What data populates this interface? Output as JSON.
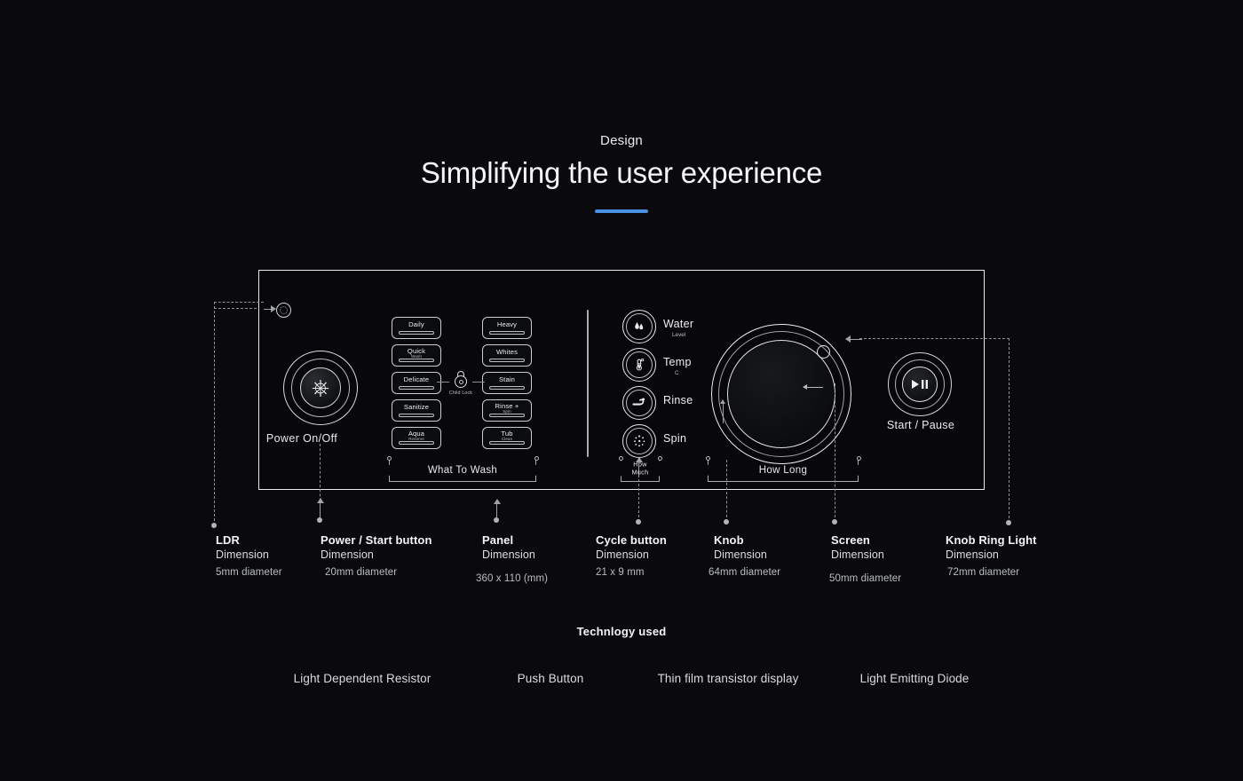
{
  "header": {
    "kicker": "Design",
    "title": "Simplifying the user experience",
    "accent": "#4a90e2"
  },
  "panel": {
    "ldr_icon": "ldr-sensor-icon",
    "power": {
      "icon": "power-icon",
      "label": "Power  On/Off"
    },
    "cycle_buttons_left": [
      {
        "name": "Daily",
        "sub": ""
      },
      {
        "name": "Quick",
        "sub": "Wash"
      },
      {
        "name": "Delicate",
        "sub": ""
      },
      {
        "name": "Sanitize",
        "sub": ""
      },
      {
        "name": "Aqua",
        "sub": "Reserve"
      }
    ],
    "cycle_buttons_right": [
      {
        "name": "Heavy",
        "sub": ""
      },
      {
        "name": "Whites",
        "sub": ""
      },
      {
        "name": "Stain",
        "sub": ""
      },
      {
        "name": "Rinse +",
        "sub": "Spin"
      },
      {
        "name": "Tub",
        "sub": "Clean"
      }
    ],
    "child_lock": {
      "label": "Child Lock",
      "icon": "lock-icon"
    },
    "bracket_what_to_wash": "What To Wash",
    "bracket_how_much": "How Much",
    "bracket_how_long": "How Long",
    "option_buttons": [
      {
        "label": "Water",
        "sub": "Level",
        "icon": "water-drops-icon"
      },
      {
        "label": "Temp",
        "sub": "C",
        "icon": "thermometer-icon"
      },
      {
        "label": "Rinse",
        "sub": "",
        "icon": "rinse-icon"
      },
      {
        "label": "Spin",
        "sub": "",
        "icon": "spin-dots-icon"
      }
    ],
    "knob": {
      "name": "time-knob",
      "notch": "knob-indicator"
    },
    "start_pause": {
      "label": "Start / Pause",
      "icon": "play-pause-icon"
    }
  },
  "callouts": [
    {
      "title": "LDR",
      "sub": "Dimension",
      "value": "5mm diameter"
    },
    {
      "title": "Power / Start  button",
      "sub": "Dimension",
      "value": "20mm diameter"
    },
    {
      "title": "Panel",
      "sub": "Dimension",
      "value": "360 x 110 (mm)"
    },
    {
      "title": "Cycle  button",
      "sub": "Dimension",
      "value": "21 x 9 mm"
    },
    {
      "title": "Knob",
      "sub": "Dimension",
      "value": "64mm diameter"
    },
    {
      "title": "Screen",
      "sub": "Dimension",
      "value": "50mm diameter"
    },
    {
      "title": "Knob Ring Light",
      "sub": "Dimension",
      "value": "72mm diameter"
    }
  ],
  "technology": {
    "heading": "Technlogy used",
    "items": [
      "Light Dependent Resistor",
      "Push Button",
      "Thin film transistor display",
      "Light Emitting Diode"
    ]
  }
}
